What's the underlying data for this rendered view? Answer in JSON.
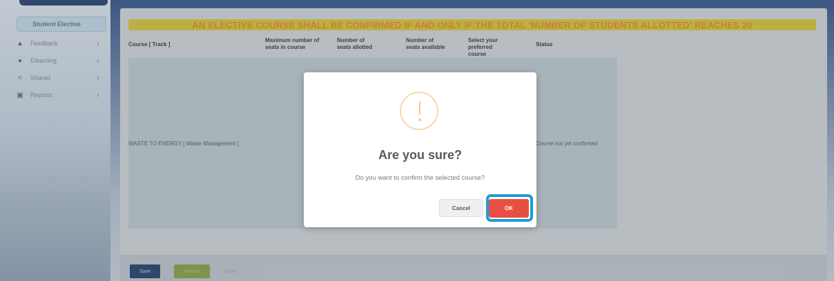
{
  "sidebar": {
    "active_item": "Student Elective",
    "items": [
      {
        "icon": "user-icon",
        "glyph": "▲",
        "label": "Feedback"
      },
      {
        "icon": "elearning-icon",
        "glyph": "●",
        "label": "Elearning"
      },
      {
        "icon": "share-icon",
        "glyph": "<",
        "label": "Shared"
      },
      {
        "icon": "print-icon",
        "glyph": "▣",
        "label": "Reports"
      }
    ],
    "chevron": "›"
  },
  "banner": {
    "text": "AN ELECTIVE COURSE SHALL BE CONFIRMED IF AND ONLY IF THE TOTAL 'NUMBER OF STUDENTS ALLOTTED' REACHES 20"
  },
  "table": {
    "headers": [
      "Course [ Track ]",
      "Maximum number of seats in course",
      "Number of seats allotted",
      "Number of seats available",
      "Select your preferred course",
      "Status"
    ],
    "rows": [
      {
        "course": "WASTE TO ENERGY [ Waste Management ]",
        "partial": "I",
        "status": "Course not yet confirmed"
      }
    ]
  },
  "footer": {
    "save_label": "Save",
    "freeze_label": "Freeze",
    "close_label": "← Close"
  },
  "modal": {
    "title": "Are you sure?",
    "text": "Do you want to confirm the selected course?",
    "cancel_label": "Cancel",
    "ok_label": "OK"
  },
  "colors": {
    "banner_bg": "#d9c744",
    "banner_text": "#e6912a",
    "ok_button": "#e84f43",
    "highlight_ring": "#1e9ad6"
  }
}
